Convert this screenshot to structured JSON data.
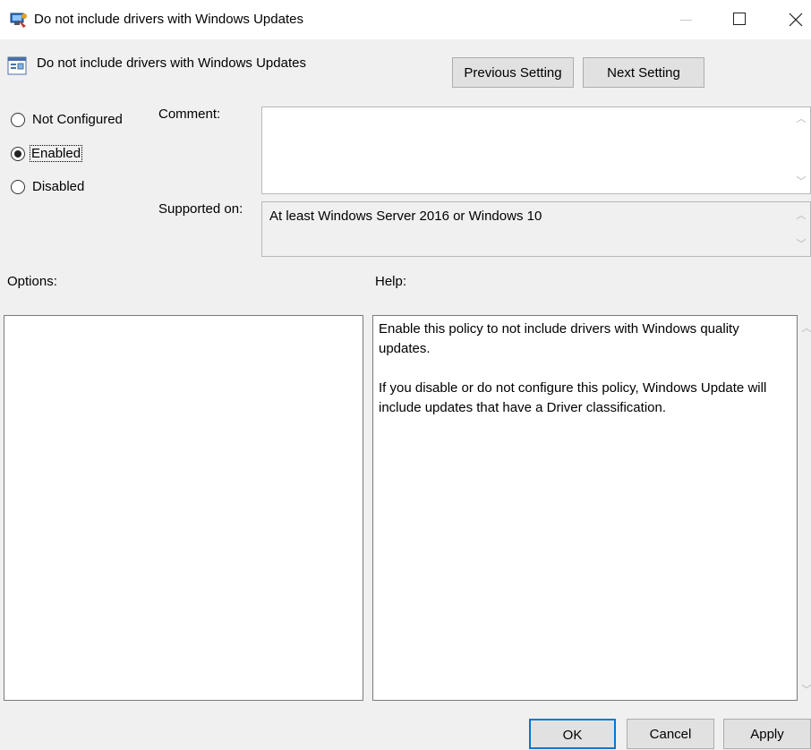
{
  "window": {
    "title": "Do not include drivers with Windows Updates",
    "icon": "policy-editor-icon"
  },
  "header": {
    "policy_name": "Do not include drivers with Windows Updates",
    "policy_icon": "policy-setting-icon",
    "previous_label": "Previous Setting",
    "next_label": "Next Setting"
  },
  "state": {
    "options": [
      {
        "label": "Not Configured",
        "selected": false
      },
      {
        "label": "Enabled",
        "selected": true
      },
      {
        "label": "Disabled",
        "selected": false
      }
    ]
  },
  "comment": {
    "label": "Comment:",
    "value": ""
  },
  "supported": {
    "label": "Supported on:",
    "value": "At least Windows Server 2016 or Windows 10"
  },
  "options_pane": {
    "label": "Options:"
  },
  "help_pane": {
    "label": "Help:",
    "paragraphs": [
      "Enable this policy to not include drivers with Windows quality updates.",
      "If you disable or do not configure this policy, Windows Update will include updates that have a Driver classification."
    ]
  },
  "footer": {
    "ok_label": "OK",
    "cancel_label": "Cancel",
    "apply_label": "Apply"
  }
}
